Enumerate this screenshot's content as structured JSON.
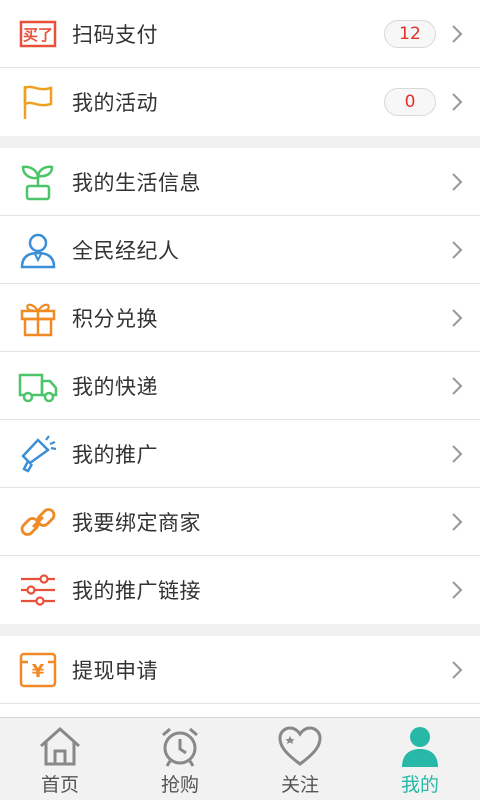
{
  "group1": [
    {
      "label": "扫码支付",
      "icon": "scan-pay-icon",
      "badge": "12"
    },
    {
      "label": "我的活动",
      "icon": "flag-icon",
      "badge": "0"
    }
  ],
  "group2": [
    {
      "label": "我的生活信息",
      "icon": "plant-icon"
    },
    {
      "label": "全民经纪人",
      "icon": "agent-person-icon"
    },
    {
      "label": "积分兑换",
      "icon": "gift-icon"
    },
    {
      "label": "我的快递",
      "icon": "truck-icon"
    },
    {
      "label": "我的推广",
      "icon": "megaphone-icon"
    },
    {
      "label": "我要绑定商家",
      "icon": "link-icon"
    },
    {
      "label": "我的推广链接",
      "icon": "sliders-icon"
    }
  ],
  "group3": [
    {
      "label": "提现申请",
      "icon": "yen-withdraw-icon"
    }
  ],
  "icon_text": {
    "scan_pay": "买了",
    "yen": "¥"
  },
  "tabs": [
    {
      "label": "首页",
      "icon": "home-icon"
    },
    {
      "label": "抢购",
      "icon": "alarm-clock-icon"
    },
    {
      "label": "关注",
      "icon": "heart-icon"
    },
    {
      "label": "我的",
      "icon": "user-icon",
      "active": true
    }
  ],
  "colors": {
    "accent": "#28b8a8",
    "badge_text": "#e0302a",
    "orange": "#f08a24",
    "green": "#4cc46a",
    "blue": "#3a8fd8",
    "red": "#e8503a"
  }
}
